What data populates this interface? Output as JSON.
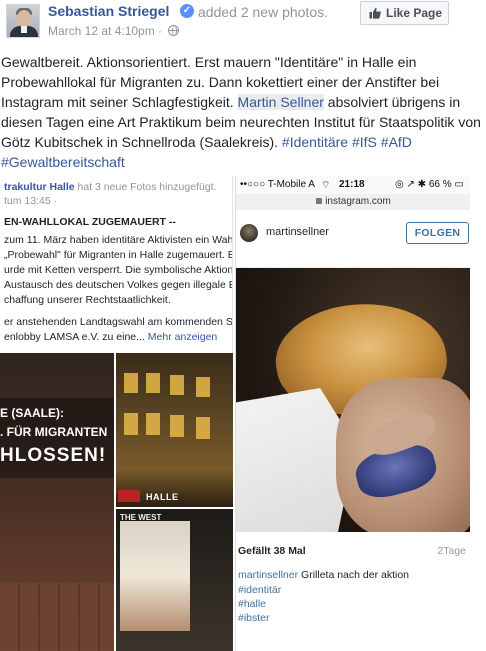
{
  "post": {
    "author": "Sebastian Striegel",
    "action": "added",
    "action_link": "2 new photos.",
    "timestamp": "March 12 at 4:10pm · ",
    "like_page_label": "Like Page",
    "text_part1": "Gewaltbereit. Aktionsorientiert. Erst mauern \"Identitäre\" in Halle ein Probewahllokal für Migranten zu. Dann kokettiert einer der Anstifter bei Instagram mit seiner Schlagfestigkeit. ",
    "mention": "Martin Sellner",
    "text_part2": " absolviert übrigens in diesen Tagen eine Art Praktikum beim neurechten Institut für Staatspolitik von Götz Kubitschek in Schnellroda (Saalekreis). ",
    "hashtags": [
      "#Identitäre",
      "#IfS",
      "#AfD",
      "#Gewaltbereitschaft"
    ]
  },
  "shared_post": {
    "source": "trakultur Halle",
    "source_suffix": " hat 3 neue Fotos hinzugefügt.",
    "meta": "tum 13:45 · ",
    "headline": "EN-WAHLLOKAL ZUGEMAUERT --",
    "lines": [
      " zum 11. März haben identitäre Aktivisten ein Wah",
      "„Probewahl\" für Migranten in Halle zugemauert. E",
      "urde mit Ketten versperrt. Die symbolische Aktion",
      "Austausch des deutschen Volkes gegen illegale Ei",
      "chaffung unserer Rechtstaatlichkeit."
    ],
    "line_a": "er anstehenden Landtagswahl am kommenden So",
    "line_b": "enlobby LAMSA e.V. zu eine... ",
    "more": "Mehr anzeigen",
    "banner": [
      "E (SAALE):",
      ". FÜR MIGRANTEN",
      "HLOSSEN!"
    ],
    "photo_label_halle": "HALLE",
    "shop_sign": "THE WEST"
  },
  "instagram": {
    "carrier": "••○○○ T-Mobile A",
    "wifi": "⌔",
    "time": "21:18",
    "right_status": "◎ ↗ ✱ 66 % ▭",
    "url": "instagram.com",
    "username": "martinsellner",
    "follow_label": "FOLGEN",
    "likes": "Gefällt 38 Mal",
    "age": "2Tage",
    "caption_user": "martinsellner",
    "caption_text": " Grilleta nach der aktion",
    "tags": [
      "#identitär",
      "#halle",
      "#ibster"
    ]
  },
  "colors": {
    "link": "#365899",
    "meta": "#90949c",
    "instagram_blue": "#3f729b"
  }
}
